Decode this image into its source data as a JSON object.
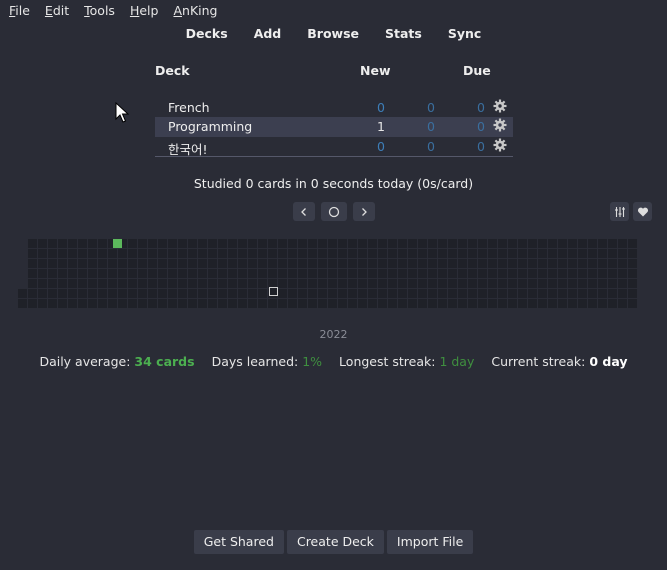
{
  "menubar": [
    "File",
    "Edit",
    "Tools",
    "Help",
    "AnKing"
  ],
  "menubar_underline": [
    "F",
    "E",
    "T",
    "H",
    "A"
  ],
  "nav": [
    "Decks",
    "Add",
    "Browse",
    "Stats",
    "Sync"
  ],
  "deck_table": {
    "headers": {
      "deck": "Deck",
      "new": "New",
      "due": "Due"
    },
    "rows": [
      {
        "name": "French",
        "new": "0",
        "learn": "0",
        "due": "0",
        "selected": false
      },
      {
        "name": "Programming",
        "new": "1",
        "learn": "0",
        "due": "0",
        "selected": true
      },
      {
        "name": "한국어!",
        "new": "0",
        "learn": "0",
        "due": "0",
        "selected": false
      }
    ]
  },
  "studied_text": "Studied 0 cards in 0 seconds today (0s/card)",
  "heatmap": {
    "year": "2022",
    "active_color": "#5cb85c",
    "empty_color": "#1f2128"
  },
  "stats": {
    "daily_avg_label": "Daily average:",
    "daily_avg_value": "34 cards",
    "days_learned_label": "Days learned:",
    "days_learned_value": "1%",
    "longest_label": "Longest streak:",
    "longest_value": "1 day",
    "current_label": "Current streak:",
    "current_value": "0 day"
  },
  "bottom_buttons": [
    "Get Shared",
    "Create Deck",
    "Import File"
  ],
  "colors": {
    "background": "#2a2c36",
    "selected_row": "#3c3f50",
    "count_blue": "#3d7eb8",
    "green": "#4caf50"
  }
}
